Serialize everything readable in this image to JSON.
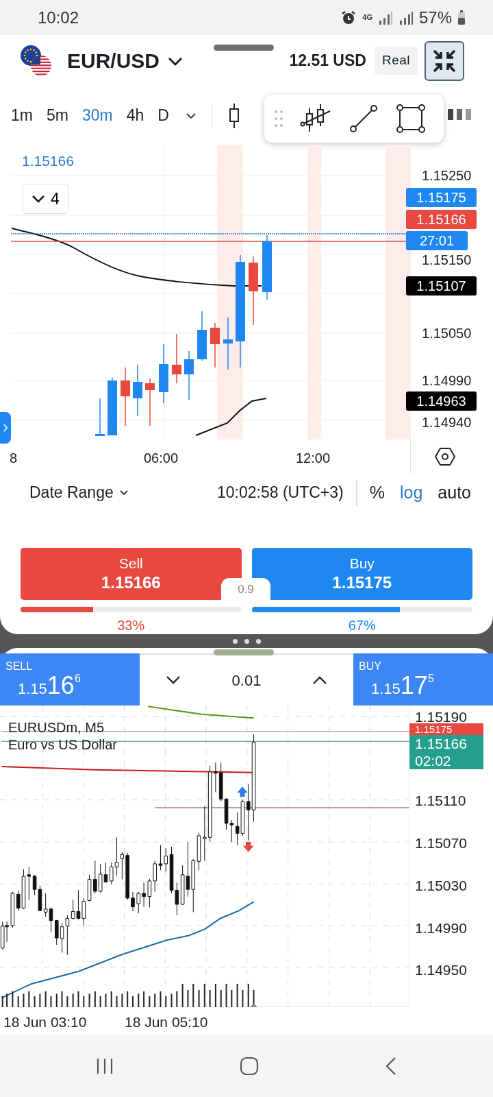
{
  "status_bar": {
    "time": "10:02",
    "network": "4G",
    "battery": "57%"
  },
  "header": {
    "symbol": "EUR/USD",
    "balance": "12.51 USD",
    "account_type": "Real"
  },
  "timeframes": [
    {
      "label": "1m",
      "selected": false
    },
    {
      "label": "5m",
      "selected": false
    },
    {
      "label": "30m",
      "selected": true
    },
    {
      "label": "4h",
      "selected": false
    },
    {
      "label": "D",
      "selected": false
    }
  ],
  "chart": {
    "last_price": "1.15166",
    "indicator_count": "4",
    "price_labels": [
      {
        "text": "1.15250",
        "kind": "tick"
      },
      {
        "text": "1.15175",
        "kind": "ask"
      },
      {
        "text": "1.15166",
        "kind": "bid"
      },
      {
        "text": "27:01",
        "kind": "timer"
      },
      {
        "text": "1.15150",
        "kind": "tick"
      },
      {
        "text": "1.15107",
        "kind": "marker"
      },
      {
        "text": "1.15050",
        "kind": "tick"
      },
      {
        "text": "1.14990",
        "kind": "tick"
      },
      {
        "text": "1.14963",
        "kind": "marker"
      },
      {
        "text": "1.14940",
        "kind": "tick"
      }
    ],
    "time_labels": [
      "8",
      "06:00",
      "12:00"
    ]
  },
  "footer": {
    "date_range": "Date Range",
    "clock": "10:02:58 (UTC+3)",
    "scales": [
      {
        "label": "%",
        "selected": false
      },
      {
        "label": "log",
        "selected": true
      },
      {
        "label": "auto",
        "selected": false
      }
    ]
  },
  "trade": {
    "sell": {
      "label": "Sell",
      "price": "1.15166"
    },
    "buy": {
      "label": "Buy",
      "price": "1.15175"
    },
    "spread": "0.9",
    "sentiment": [
      {
        "color": "#e8483f",
        "share": "33%",
        "level": 0.33
      },
      {
        "color": "#1e88f0",
        "share": "67%",
        "level": 0.67
      }
    ]
  },
  "mt_trade": {
    "sell": {
      "label": "SELL",
      "price_prefix": "1.15",
      "price_big": "16",
      "price_sup": "6"
    },
    "volume": "0.01",
    "buy": {
      "label": "BUY",
      "price_prefix": "1.15",
      "price_big": "17",
      "price_sup": "5"
    }
  },
  "mt_chart": {
    "symbol_line": "EURUSDm, M5",
    "description": "Euro vs US Dollar",
    "price_labels": [
      {
        "text": "1.15190",
        "kind": "tick"
      },
      {
        "text": "1.15175",
        "kind": "ask"
      },
      {
        "text": "1.15166",
        "kind": "bid"
      },
      {
        "text": "02:02",
        "kind": "timer"
      },
      {
        "text": "1.15110",
        "kind": "tick"
      },
      {
        "text": "1.15070",
        "kind": "tick"
      },
      {
        "text": "1.15030",
        "kind": "tick"
      },
      {
        "text": "1.14990",
        "kind": "tick"
      },
      {
        "text": "1.14950",
        "kind": "tick"
      }
    ],
    "time_labels": [
      "18 Jun 03:10",
      "18 Jun 05:10"
    ]
  }
}
